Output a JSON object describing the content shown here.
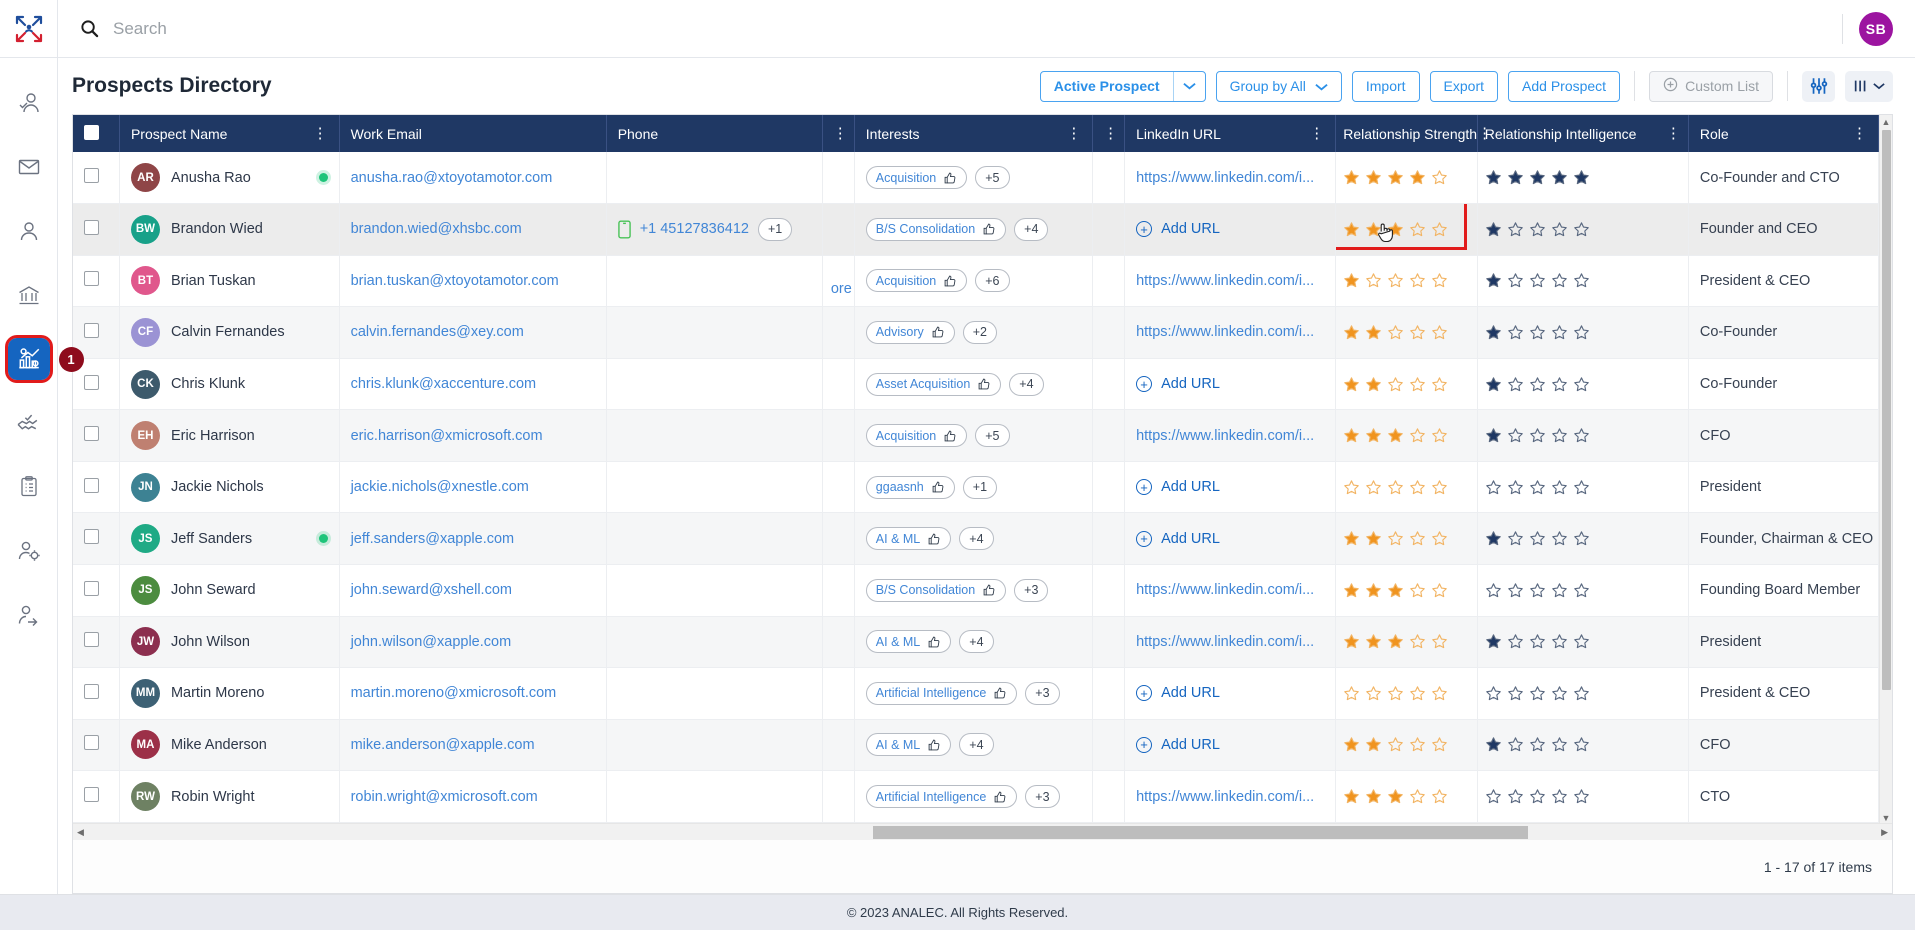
{
  "app": {
    "logo_icon": "analec-logo-icon",
    "footer_text": "© 2023 ANALEC. All Rights Reserved."
  },
  "search": {
    "placeholder": "Search",
    "value": "",
    "icon": "search-icon"
  },
  "user": {
    "initials": "SB"
  },
  "sidebar": {
    "items": [
      {
        "name": "sidebar-item-contacts",
        "icon": "person-check-icon",
        "active": false
      },
      {
        "name": "sidebar-item-mail",
        "icon": "envelope-icon",
        "active": false
      },
      {
        "name": "sidebar-item-profile",
        "icon": "person-icon",
        "active": false
      },
      {
        "name": "sidebar-item-institutions",
        "icon": "bank-icon",
        "active": false
      },
      {
        "name": "sidebar-item-prospects",
        "icon": "analytics-gear-icon",
        "active": true,
        "badge": "1"
      },
      {
        "name": "sidebar-item-deals",
        "icon": "handshake-check-icon",
        "active": false
      },
      {
        "name": "sidebar-item-tasks",
        "icon": "clipboard-list-icon",
        "active": false
      },
      {
        "name": "sidebar-item-user-settings",
        "icon": "person-gear-icon",
        "active": false
      },
      {
        "name": "sidebar-item-referrals",
        "icon": "person-arrow-icon",
        "active": false
      }
    ]
  },
  "header": {
    "title": "Prospects Directory",
    "filter_label": "Active Prospect",
    "group_label": "Group by All",
    "import_label": "Import",
    "export_label": "Export",
    "add_prospect_label": "Add Prospect",
    "custom_list_label": "Custom List",
    "settings_icon": "sliders-icon",
    "columns_icon": "columns-chooser-icon"
  },
  "table": {
    "columns": [
      {
        "key": "select",
        "label": "",
        "kebab": false
      },
      {
        "key": "prospect_name",
        "label": "Prospect Name",
        "kebab": true
      },
      {
        "key": "work_email",
        "label": "Work Email",
        "kebab": false
      },
      {
        "key": "phone",
        "label": "Phone",
        "kebab": false
      },
      {
        "key": "phone_menu",
        "label": "",
        "kebab": true
      },
      {
        "key": "interests",
        "label": "Interests",
        "kebab": true
      },
      {
        "key": "interests_menu",
        "label": "",
        "kebab": true
      },
      {
        "key": "linkedin_url",
        "label": "LinkedIn URL",
        "kebab": true
      },
      {
        "key": "relationship_strength",
        "label": "Relationship Strength",
        "kebab": true
      },
      {
        "key": "relationship_intelligence",
        "label": "Relationship Intelligence",
        "kebab": true
      },
      {
        "key": "role",
        "label": "Role",
        "kebab": true
      }
    ],
    "add_url_label": "Add URL",
    "truncated_text": "ore",
    "rows": [
      {
        "initials": "AR",
        "color": "#8f4547",
        "name": "Anusha Rao",
        "online": true,
        "email": "anusha.rao@xtoyotamotor.com",
        "phone": "",
        "phone_extra": "",
        "interest": "Acquisition",
        "interest_extra": "+5",
        "linkedin": "https://www.linkedin.com/i...",
        "strength": 4,
        "intelligence": 5,
        "role": "Co-Founder and CTO"
      },
      {
        "initials": "BW",
        "color": "#18a189",
        "name": "Brandon Wied",
        "online": false,
        "email": "brandon.wied@xhsbc.com",
        "phone": "+1 45127836412",
        "phone_extra": "+1",
        "interest": "B/S Consolidation",
        "interest_extra": "+4",
        "linkedin": "",
        "strength": 3,
        "intelligence": 1,
        "role": "Founder and CEO",
        "highlight": true
      },
      {
        "initials": "BT",
        "color": "#e0578c",
        "name": "Brian Tuskan",
        "online": false,
        "email": "brian.tuskan@xtoyotamotor.com",
        "phone": "",
        "phone_extra": "",
        "interest": "Acquisition",
        "interest_extra": "+6",
        "linkedin": "https://www.linkedin.com/i...",
        "strength": 1,
        "intelligence": 1,
        "role": "President & CEO"
      },
      {
        "initials": "CF",
        "color": "#9b93d4",
        "name": "Calvin Fernandes",
        "online": false,
        "email": "calvin.fernandes@xey.com",
        "phone": "",
        "phone_extra": "",
        "interest": "Advisory",
        "interest_extra": "+2",
        "linkedin": "https://www.linkedin.com/i...",
        "strength": 2,
        "intelligence": 1,
        "role": "Co-Founder"
      },
      {
        "initials": "CK",
        "color": "#3d5a6c",
        "name": "Chris Klunk",
        "online": false,
        "email": "chris.klunk@xaccenture.com",
        "phone": "",
        "phone_extra": "",
        "interest": "Asset Acquisition",
        "interest_extra": "+4",
        "linkedin": "",
        "strength": 2,
        "intelligence": 1,
        "role": "Co-Founder"
      },
      {
        "initials": "EH",
        "color": "#bf8071",
        "name": "Eric Harrison",
        "online": false,
        "email": "eric.harrison@xmicrosoft.com",
        "phone": "",
        "phone_extra": "",
        "interest": "Acquisition",
        "interest_extra": "+5",
        "linkedin": "https://www.linkedin.com/i...",
        "strength": 3,
        "intelligence": 1,
        "role": "CFO"
      },
      {
        "initials": "JN",
        "color": "#3d8293",
        "name": "Jackie Nichols",
        "online": false,
        "email": "jackie.nichols@xnestle.com",
        "phone": "",
        "phone_extra": "",
        "interest": "ggaasnh",
        "interest_extra": "+1",
        "linkedin": "",
        "strength": 0,
        "intelligence": 0,
        "role": "President"
      },
      {
        "initials": "JS",
        "color": "#1faa85",
        "name": "Jeff Sanders",
        "online": true,
        "email": "jeff.sanders@xapple.com",
        "phone": "",
        "phone_extra": "",
        "interest": "AI & ML",
        "interest_extra": "+4",
        "linkedin": "",
        "strength": 2,
        "intelligence": 1,
        "role": "Founder, Chairman & CEO"
      },
      {
        "initials": "JS",
        "color": "#4c8c3f",
        "name": "John Seward",
        "online": false,
        "email": "john.seward@xshell.com",
        "phone": "",
        "phone_extra": "",
        "interest": "B/S Consolidation",
        "interest_extra": "+3",
        "linkedin": "https://www.linkedin.com/i...",
        "strength": 3,
        "intelligence": 0,
        "role": "Founding Board Member"
      },
      {
        "initials": "JW",
        "color": "#8c2f4f",
        "name": "John Wilson",
        "online": false,
        "email": "john.wilson@xapple.com",
        "phone": "",
        "phone_extra": "",
        "interest": "AI & ML",
        "interest_extra": "+4",
        "linkedin": "https://www.linkedin.com/i...",
        "strength": 3,
        "intelligence": 1,
        "role": "President"
      },
      {
        "initials": "MM",
        "color": "#3d6175",
        "name": "Martin Moreno",
        "online": false,
        "email": "martin.moreno@xmicrosoft.com",
        "phone": "",
        "phone_extra": "",
        "interest": "Artificial Intelligence",
        "interest_extra": "+3",
        "linkedin": "",
        "strength": 0,
        "intelligence": 0,
        "role": "President & CEO"
      },
      {
        "initials": "MA",
        "color": "#9c3048",
        "name": "Mike Anderson",
        "online": false,
        "email": "mike.anderson@xapple.com",
        "phone": "",
        "phone_extra": "",
        "interest": "AI & ML",
        "interest_extra": "+4",
        "linkedin": "",
        "strength": 2,
        "intelligence": 1,
        "role": "CFO"
      },
      {
        "initials": "RW",
        "color": "#6e8163",
        "name": "Robin Wright",
        "online": false,
        "email": "robin.wright@xmicrosoft.com",
        "phone": "",
        "phone_extra": "",
        "interest": "Artificial Intelligence",
        "interest_extra": "+3",
        "linkedin": "https://www.linkedin.com/i...",
        "strength": 3,
        "intelligence": 0,
        "role": "CTO"
      }
    ]
  },
  "pager": {
    "items_text": "1 - 17 of 17 items"
  },
  "annotations": [
    {
      "id": "1",
      "target": "sidebar-item-prospects"
    },
    {
      "id": "2",
      "target": "relationship-strength-cell-brandon-wied"
    }
  ],
  "colors": {
    "header_bg": "#1f3864",
    "accent_blue": "#1565c0",
    "link_blue": "#4186d6",
    "star_on": "#f0941f",
    "star_off": "#f2b463",
    "star_blue_on": "#1f3864",
    "highlight_red": "#e11b1b",
    "badge_maroon": "#8e0b1c"
  }
}
